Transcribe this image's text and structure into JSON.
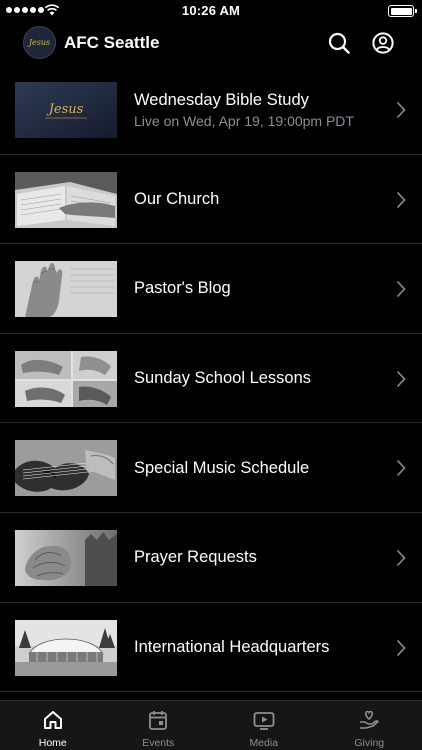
{
  "status_bar": {
    "time": "10:26 AM"
  },
  "header": {
    "title": "AFC Seattle",
    "logo_text": "Jesus"
  },
  "items": [
    {
      "title": "Wednesday Bible Study",
      "subtitle": "Live on Wed, Apr 19, 19:00pm PDT",
      "thumb_text": "Jesus"
    },
    {
      "title": "Our Church"
    },
    {
      "title": "Pastor's Blog"
    },
    {
      "title": "Sunday School Lessons"
    },
    {
      "title": "Special Music Schedule"
    },
    {
      "title": "Prayer Requests"
    },
    {
      "title": "International Headquarters"
    }
  ],
  "tabs": [
    {
      "label": "Home",
      "icon": "home-icon",
      "active": true
    },
    {
      "label": "Events",
      "icon": "calendar-icon"
    },
    {
      "label": "Media",
      "icon": "play-icon"
    },
    {
      "label": "Giving",
      "icon": "giving-icon"
    }
  ],
  "colors": {
    "background": "#000000",
    "divider": "#2c2c2e",
    "secondary_text": "#8e8e93",
    "tabbar": "#161616",
    "logo_gold": "#d6b24a"
  }
}
